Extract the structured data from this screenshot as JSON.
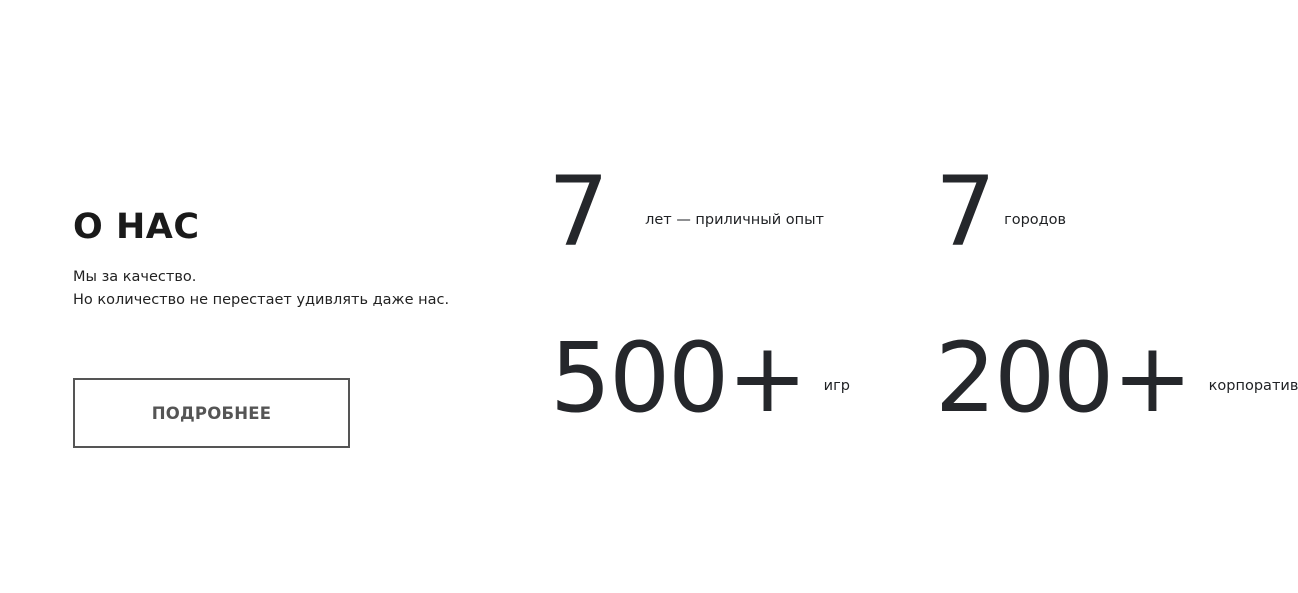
{
  "about": {
    "title": "О НАС",
    "text_line_1": "Мы за качество.",
    "text_line_2": "Но количество не перестает удивлять даже нас.",
    "button_label": "ПОДРОБНЕЕ"
  },
  "stats": {
    "years": {
      "number": "7",
      "label": "лет — приличный опыт"
    },
    "cities": {
      "number": "7",
      "label": "городов"
    },
    "games": {
      "number": "500+",
      "label": "игр"
    },
    "corporates": {
      "number": "200+",
      "label": "корпоративов"
    }
  },
  "colors": {
    "background": "#ffffff",
    "text": "#1f2124",
    "button_border": "#555555"
  }
}
